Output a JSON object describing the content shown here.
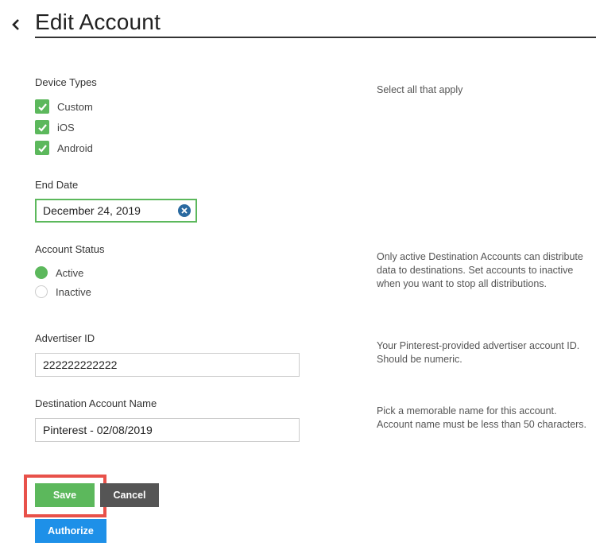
{
  "header": {
    "title": "Edit Account"
  },
  "device_types": {
    "label": "Device Types",
    "help": "Select all that apply",
    "options": [
      {
        "label": "Custom",
        "checked": true
      },
      {
        "label": "iOS",
        "checked": true
      },
      {
        "label": "Android",
        "checked": true
      }
    ]
  },
  "end_date": {
    "label": "End Date",
    "value": "December 24, 2019"
  },
  "account_status": {
    "label": "Account Status",
    "help": "Only active Destination Accounts can distribute data to destinations. Set accounts to inactive when you want to stop all distributions.",
    "options": [
      {
        "label": "Active",
        "selected": true
      },
      {
        "label": "Inactive",
        "selected": false
      }
    ]
  },
  "advertiser_id": {
    "label": "Advertiser ID",
    "value": "222222222222",
    "help": "Your Pinterest-provided advertiser account ID. Should be numeric."
  },
  "destination_account_name": {
    "label": "Destination Account Name",
    "value": "Pinterest - 02/08/2019",
    "help": "Pick a memorable name for this account. Account name must be less than 50 characters."
  },
  "actions": {
    "save": "Save",
    "cancel": "Cancel",
    "authorize": "Authorize"
  },
  "colors": {
    "accent_green": "#5cb85c",
    "highlight_red": "#e8514a",
    "authorize_blue": "#1e90e8",
    "clear_blue": "#2a6aa0"
  }
}
